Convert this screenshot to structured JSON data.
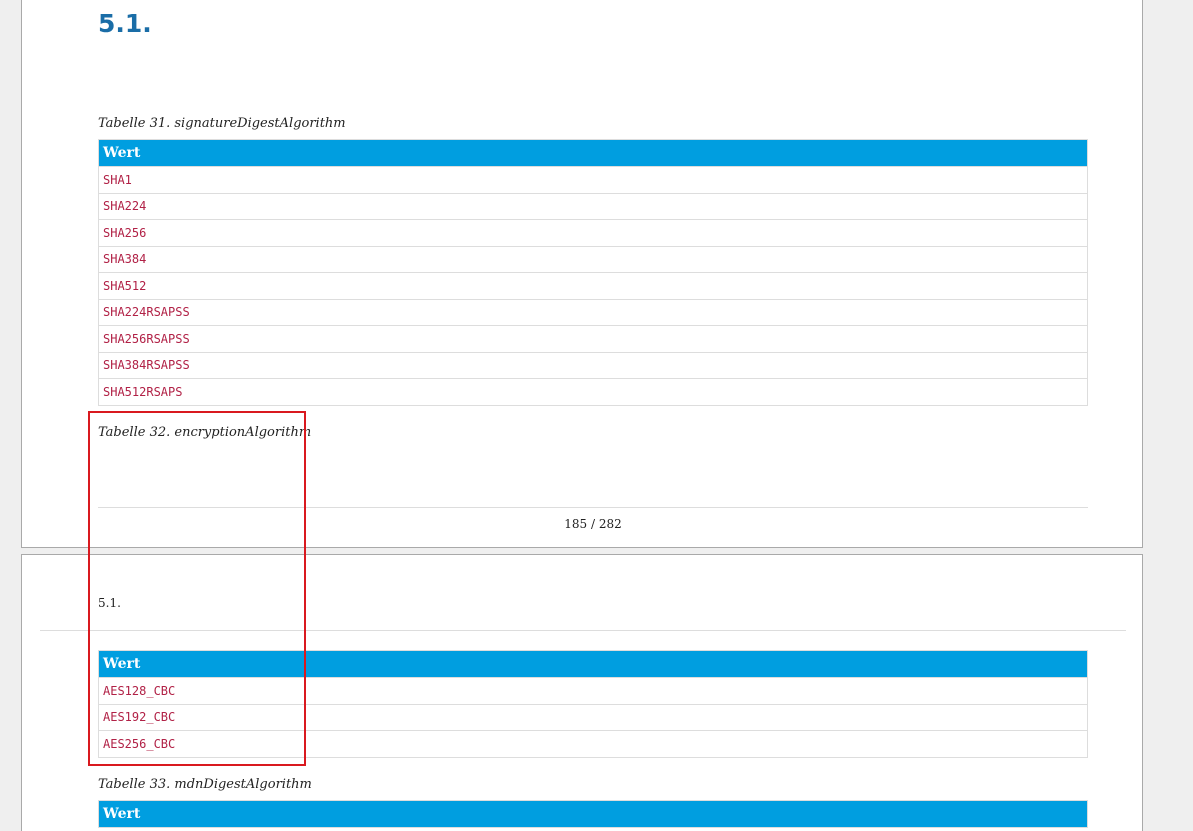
{
  "page1": {
    "section_heading": "5.1.",
    "table31": {
      "caption": "Tabelle 31. signatureDigestAlgorithm",
      "header": "Wert",
      "rows": [
        "SHA1",
        "SHA224",
        "SHA256",
        "SHA384",
        "SHA512",
        "SHA224RSAPSS",
        "SHA256RSAPSS",
        "SHA384RSAPSS",
        "SHA512RSAPS"
      ]
    },
    "table32_caption": "Tabelle 32. encryptionAlgorithm",
    "page_number": "185 / 282"
  },
  "page2": {
    "running_header": "5.1.",
    "table32": {
      "header": "Wert",
      "rows": [
        "AES128_CBC",
        "AES192_CBC",
        "AES256_CBC"
      ]
    },
    "table33": {
      "caption": "Tabelle 33. mdnDigestAlgorithm",
      "header": "Wert"
    }
  },
  "colors": {
    "table_header": "#009ee0",
    "code_text": "#b12146",
    "heading": "#1a6da7",
    "highlight": "#d9191f"
  }
}
